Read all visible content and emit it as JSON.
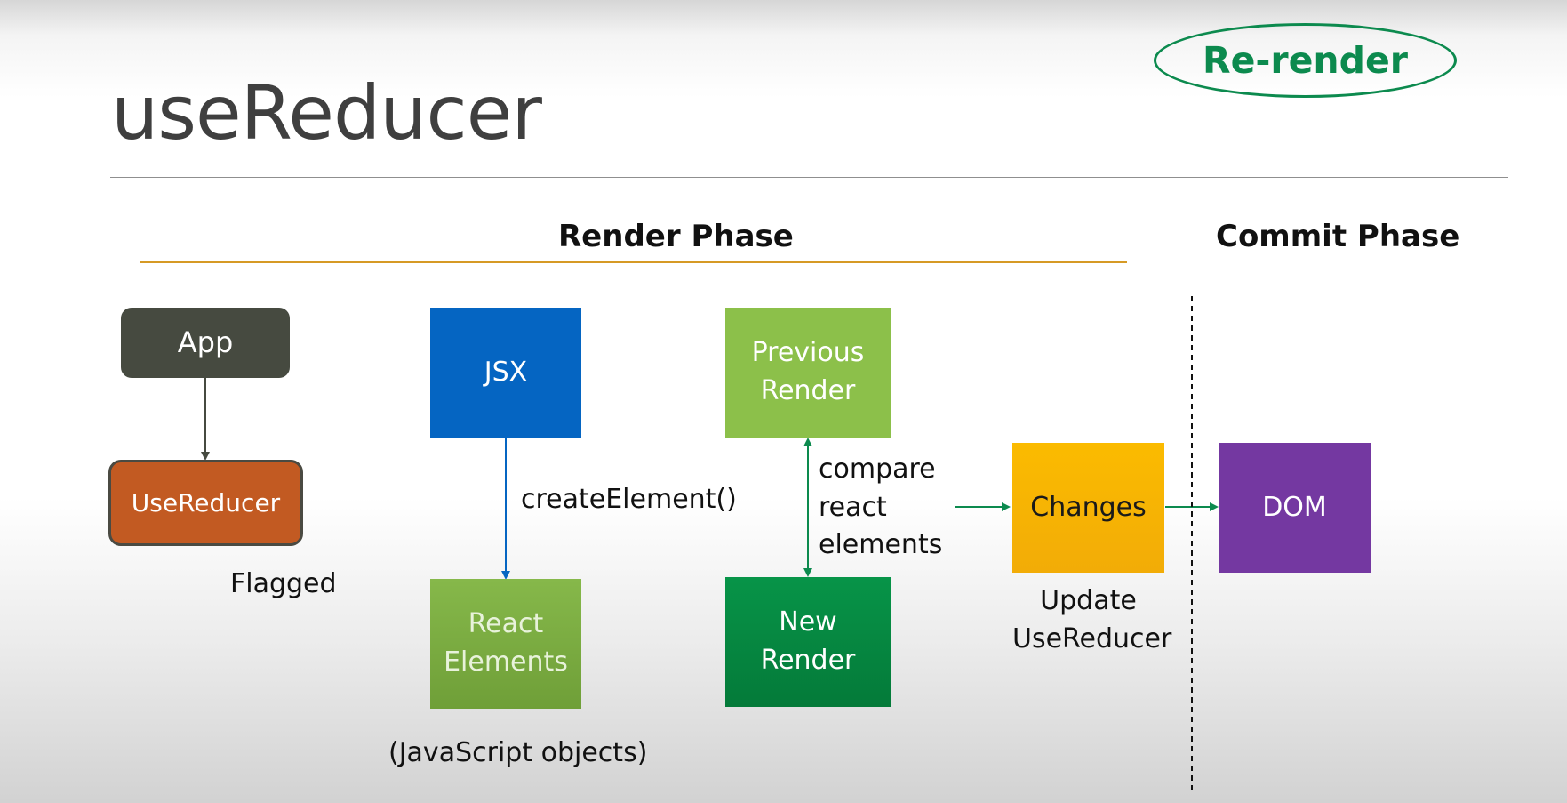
{
  "slide": {
    "title": "useReducer",
    "badge": "Re-render"
  },
  "phases": {
    "render": "Render Phase",
    "commit": "Commit Phase"
  },
  "nodes": {
    "app": "App",
    "use_reducer": "UseReducer",
    "jsx": "JSX",
    "react_elements": [
      "React",
      "Elements"
    ],
    "previous_render": [
      "Previous",
      "Render"
    ],
    "new_render": [
      "New",
      "Render"
    ],
    "changes": "Changes",
    "dom": "DOM"
  },
  "captions": {
    "flagged": "Flagged",
    "create_element": "createElement()",
    "javascript_objects": "(JavaScript objects)",
    "compare": [
      "compare",
      "react",
      "elements"
    ],
    "update": [
      "Update",
      "UseReducer"
    ]
  },
  "colors": {
    "app": "#464a40",
    "use_reducer": "#c25a22",
    "jsx": "#0565c2",
    "react_elements": "#7aac3e",
    "previous_render": "#8cc04a",
    "new_render": "#058b42",
    "changes": "#f8b400",
    "dom": "#7438a1",
    "green_accent": "#0c8a4e",
    "render_rule": "#d69a25"
  }
}
